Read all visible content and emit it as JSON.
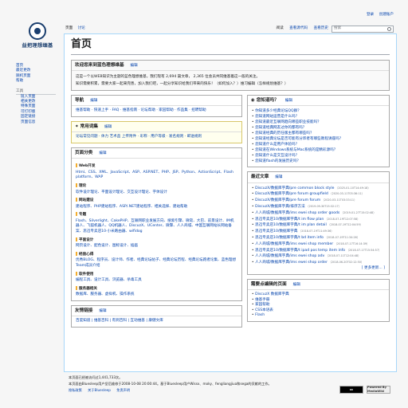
{
  "personal": {
    "login": "登录",
    "create": "创建账户"
  },
  "logo": {
    "text": "益把理想缅基"
  },
  "tabs": {
    "page": "页面",
    "talk": "讨论",
    "read": "阅读",
    "view_source": "查看源代码",
    "history": "查看历史",
    "search_placeholder": "搜索"
  },
  "sidebar": {
    "nav": [
      "首页",
      "最近更改",
      "随机页面",
      "帮助"
    ],
    "tools_head": "工具",
    "tools": [
      "链入页面",
      "相关更改",
      "特殊页面",
      "可打印版",
      "固定链接",
      "页面信息"
    ]
  },
  "page_title": "首页",
  "welcome": {
    "title": "欢迎您来到蓝色理想维基",
    "edit": "编辑",
    "line1": "这是一个以WEB知识为主题的蓝色理想维基，我们现有 2,694 篇文章， 2,365 位会员共同维基着这一般的关注。",
    "line2": "知识需要积累，需要大家一起来完善，加入我们吧，一起分享知识给我们带来的快乐！（如何加入？）维习编辑（怎样规划维基？）"
  },
  "nav_box": {
    "title": "导航",
    "edit": "编辑",
    "text": "维基帮助 · 快速上手 · FAQ · 维基指南 · 论坛帮助 · 家园帮助 · 作品集 · 招聘帮助"
  },
  "common_words": {
    "title": "常用词集",
    "edit": "编辑",
    "text": "论坛常见问题 · 体力 艺术品 上传附件 · 彩称 · 用户等级 · 发名规则 · 邮送规则"
  },
  "categories": {
    "title": "页面分类",
    "edit": "编辑",
    "groups": [
      {
        "name": "Web开发",
        "text": "Html、CSS、XML、JavaScript、ASP、ASP.NET、PHP、JSP、Python、ActionScript、Flash platform、WAP"
      },
      {
        "name": "理论",
        "text": "软件设计理论、平面设计理论、交互设计理论、字体设计"
      },
      {
        "name": "网站建设",
        "text": "建站程序、PHP建站程序、ASP/.NET建站程序、相关选择、建站帮助"
      },
      {
        "name": "专题",
        "text": "Flash、Silverlight、CakePHP、互联网职业发展方向、搜索引擎、微软、大巴、前景设计、IM机器人、飞狐机器人、QQ机器人、DiscuzX、UCenter、微擎、人人商城、中国互联网站长网站备案、思迅专卖店10·小米路由器、wifidog"
      },
      {
        "name": "平面设计",
        "text": "网页设计、配色设计、图标设计、插画"
      },
      {
        "name": "经验心得",
        "text": "优秀BLOG、程序员、设计师、作者、经典论坛帖子、经典论坛历程、经典论坛跑者论集、蓝色理想Team成员介绍"
      },
      {
        "name": "软件使用",
        "text": "编程工具、设计工具、浏览器、杀毒工具"
      },
      {
        "name": "服务器相关",
        "text": "数据库、服务器、虚拟机、操作系统"
      }
    ]
  },
  "friends": {
    "title": "友情链接",
    "edit": "编辑",
    "text": "百度知道 | 维基百科 | 有到百科 | 互动维基 | 康健文库"
  },
  "faq": {
    "title": "您知道吗？",
    "edit": "编辑",
    "items": [
      "你知道多少经典论坛QQ群？",
      "您知道网站运营是什么吗？",
      "您知道最近互联网趋向哪些职业技能吗？",
      "您知道经典网友过你的都有吗？",
      "您知道经典的历任版主都有哪些吗？",
      "您知道经典论坛是否可能有分饰者有哪些教程讲座吗？",
      "您知道什么是用户体验吗？",
      "您知道在Windows系统与Mac系统的是精彩源吗？",
      "您知道什么是交互设计吗？",
      "您知道flash的发展历史吗？"
    ]
  },
  "recent": {
    "title": "最近文章",
    "edit": "编辑",
    "items": [
      {
        "text": "DiscuzX/数据库字典/pre common block style",
        "meta": "（2025-01-10T14:49:18）"
      },
      {
        "text": "DiscuzX/数据库字典/pre forum groupfield",
        "meta": "（2020-03-11T03:36:11）"
      },
      {
        "text": "DiscuzX/数据库字典/pre forum forum",
        "meta": "（2020-03-11T03:33:11）"
      },
      {
        "text": "DiscuzX/数据库字典/排序方法",
        "meta": "（2019-09-30T15:32:17）"
      },
      {
        "text": "人人商城/数据库字典/ims ewei shop order goods",
        "meta": "（2019-01-27T15:02:48）"
      },
      {
        "text": "思迅专卖店10/数据库字典/t im flow plan",
        "meta": "（2018-07-19T12:07:58）"
      },
      {
        "text": "思迅专卖店10/数据库字典/t im plan detail",
        "meta": "（2018-07-19T12:04:59）"
      },
      {
        "text": "思迅专卖店10/数据库字典",
        "meta": "（2018-07-19T11:49:36）"
      },
      {
        "text": "思迅专卖店10/数据库字典/t bd item info",
        "meta": "（2018-07-19T11:34:26）"
      },
      {
        "text": "人人商城/数据库字典/ims ewei shop member",
        "meta": "（2018-07-17T16:14:39）"
      },
      {
        "text": "思迅专卖店10/数据库字典/t ipad pos temp item info",
        "meta": "（2018-07-17T15:54:57）"
      },
      {
        "text": "人人商城/数据库字典/ims ewei shop adv",
        "meta": "（2018-07-11T12:04:48）"
      },
      {
        "text": "人人商城/数据库字典/ims ewei shop order",
        "meta": "（2018-06-20T02:12:50）"
      }
    ],
    "more": "[ 更多更新... ]"
  },
  "needed": {
    "title": "需要点编辑的页面",
    "edit": "编辑",
    "items": [
      "DiscuzX 数据库字典",
      "维基手册",
      "家园帮助",
      "CSS本语表",
      "Flash"
    ]
  },
  "footer": {
    "line1": "本页面已经被访问过1,441,733次。",
    "line2": "本页面由Bluesleep用户坚后维修于2008-10-08 20:00:44。基于Bluesleep用户Wissx、moky、fengliangjiua和sega的贡献的工作。",
    "links": [
      "隐私政策",
      "关于Bluesleep",
      "免责声明"
    ]
  },
  "badges": {
    "cc": "cc",
    "mw": "Powered By MediaWiki"
  }
}
